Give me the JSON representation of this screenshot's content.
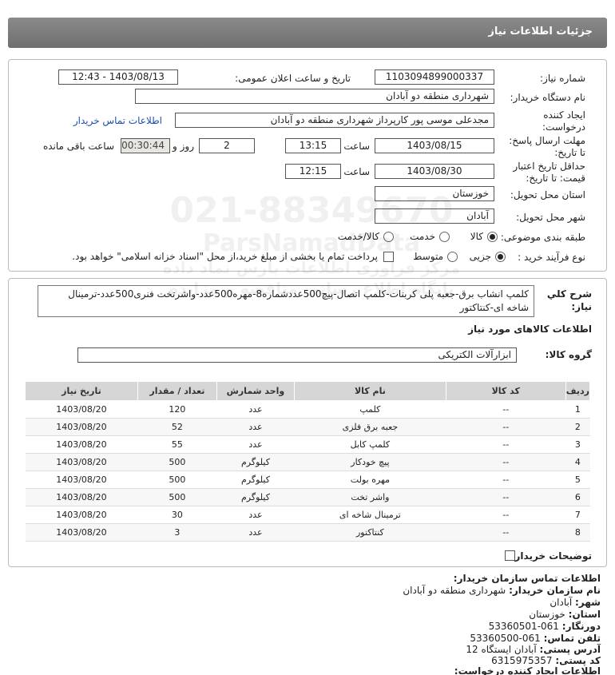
{
  "header": {
    "title": "جزئیات اطلاعات نیاز"
  },
  "form": {
    "need_number": {
      "label": "شماره نیاز:",
      "value": "1103094899000337"
    },
    "announce": {
      "label": "تاریخ و ساعت اعلان عمومی:",
      "value": "1403/08/13 - 12:43"
    },
    "buyer_org": {
      "label": "نام دستگاه خریدار:",
      "value": "شهرداری منطقه دو آبادان"
    },
    "creator": {
      "label_1": "ایجاد کننده",
      "label_2": "درخواست:",
      "value": "مجدعلی موسی پور کارپرداز شهرداری منطقه دو آبادان",
      "contact_link": "اطلاعات تماس خریدار"
    },
    "deadline": {
      "label_1": "مهلت ارسال پاسخ:",
      "label_2": "تا تاریخ:",
      "date": "1403/08/15",
      "time_label": "ساعت",
      "time": "13:15",
      "days": "2",
      "days_label": "روز و",
      "remaining": "00:30:44",
      "remaining_label": "ساعت باقی مانده"
    },
    "validity": {
      "label_1": "حداقل تاریخ اعتبار",
      "label_2": "قیمت: تا تاریخ:",
      "date": "1403/08/30",
      "time_label": "ساعت",
      "time": "12:15"
    },
    "province": {
      "label": "استان محل تحویل:",
      "value": "خوزستان"
    },
    "city": {
      "label": "شهر محل تحویل:",
      "value": "آبادان"
    },
    "category": {
      "label": "طبقه بندی موضوعی:",
      "options": [
        "کالا",
        "خدمت",
        "کالا/خدمت"
      ],
      "selected": "کالا"
    },
    "process": {
      "label": "نوع فرآیند خرید :",
      "options": [
        "جزیی",
        "متوسط"
      ],
      "selected": "جزیی",
      "payment_note": "پرداخت تمام یا بخشی از مبلغ خرید،از محل \"اسناد خزانه اسلامی\" خواهد بود."
    }
  },
  "summary": {
    "label_1": "شرح کلي",
    "label_2": "نياز:",
    "text": "کلمپ انشاب برق-جعبه پلی کربنات-کلمپ اتصال-پیچ500عددشماره8-مهره500عدد-واشرتخت فنری500عدد-ترمینال شاخه ای-کنتاکتور"
  },
  "goods": {
    "section_title": "اطلاعات کالاهای مورد نیاز",
    "group_label": "گروه کالا:",
    "group_value": "ابزارآلات الکتریکی",
    "columns": [
      "ردیف",
      "کد کالا",
      "نام کالا",
      "واحد شمارش",
      "تعداد / مقدار",
      "تاریخ نیاز"
    ],
    "rows": [
      {
        "idx": "1",
        "code": "--",
        "name": "کلمپ",
        "unit": "عدد",
        "qty": "120",
        "date": "1403/08/20"
      },
      {
        "idx": "2",
        "code": "--",
        "name": "جعبه برق فلزی",
        "unit": "عدد",
        "qty": "52",
        "date": "1403/08/20"
      },
      {
        "idx": "3",
        "code": "--",
        "name": "کلمپ کابل",
        "unit": "عدد",
        "qty": "55",
        "date": "1403/08/20"
      },
      {
        "idx": "4",
        "code": "--",
        "name": "پیچ خودکار",
        "unit": "کیلوگرم",
        "qty": "500",
        "date": "1403/08/20"
      },
      {
        "idx": "5",
        "code": "--",
        "name": "مهره بولت",
        "unit": "کیلوگرم",
        "qty": "500",
        "date": "1403/08/20"
      },
      {
        "idx": "6",
        "code": "--",
        "name": "واشر تخت",
        "unit": "کیلوگرم",
        "qty": "500",
        "date": "1403/08/20"
      },
      {
        "idx": "7",
        "code": "--",
        "name": "ترمینال شاخه ای",
        "unit": "عدد",
        "qty": "30",
        "date": "1403/08/20"
      },
      {
        "idx": "8",
        "code": "--",
        "name": "کنتاکتور",
        "unit": "عدد",
        "qty": "3",
        "date": "1403/08/20"
      }
    ],
    "buyer_notes_label": "توضیحات خریدار:"
  },
  "contact": {
    "title": "اطلاعات تماس سازمان خریدار:",
    "org_label": "نام سازمان خریدار:",
    "org": "شهرداری منطقه دو آبادان",
    "city_label": "شهر:",
    "city": "آبادان",
    "province_label": "استان:",
    "province": "خوزستان",
    "fax_label": "دورنگار:",
    "fax": "061-53360501",
    "phone_label": "تلفن تماس:",
    "phone": "061-53360500",
    "address_label": "آدرس پستی:",
    "address": "آبادان ایستگاه 12",
    "postal_label": "کد پستی:",
    "postal": "6315975357",
    "creator_title": "اطلاعات ایجاد کننده درخواست:"
  },
  "watermark": {
    "line1": "021-88349670",
    "line2": "ParsNamadData",
    "line3": "مرکز فراوری اطلاعات پارس نماد داده",
    "line4": "پایگاه اطلاع رسانی مناقصه و مزایده"
  }
}
